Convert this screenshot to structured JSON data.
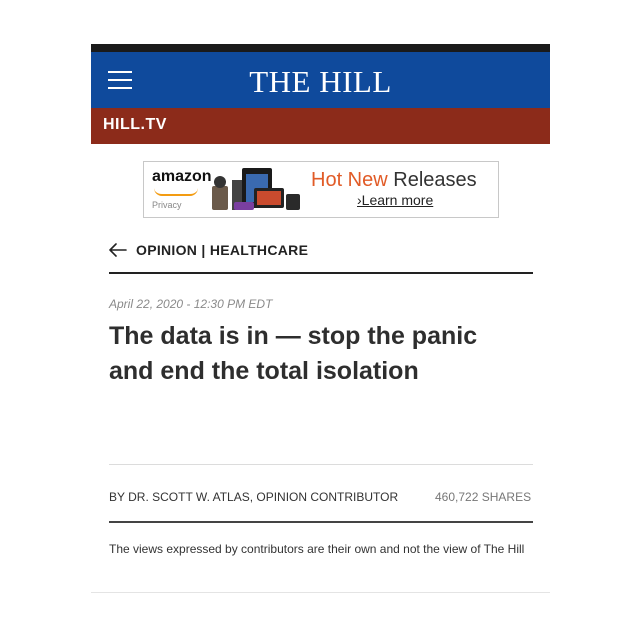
{
  "header": {
    "brand": "THE HILL",
    "section_label": "HILL.TV"
  },
  "ad": {
    "logo": "amazon",
    "privacy": "Privacy",
    "headline_hot": "Hot New",
    "headline_rest": "Releases",
    "cta": "›Learn more"
  },
  "article": {
    "breadcrumb": "OPINION | HEALTHCARE",
    "date": "April 22, 2020 - 12:30 PM EDT",
    "title": "The data is in — stop the panic and end the total isolation",
    "byline": "BY DR. SCOTT W. ATLAS, OPINION CONTRIBUTOR",
    "shares_count": "460,722",
    "shares_label": "SHARES",
    "disclaimer": "The views expressed by contributors are their own and not the view of The Hill"
  },
  "colors": {
    "header_blue": "#0f4a9c",
    "subbar_red": "#8c2b1a",
    "ad_orange": "#e15b27"
  }
}
